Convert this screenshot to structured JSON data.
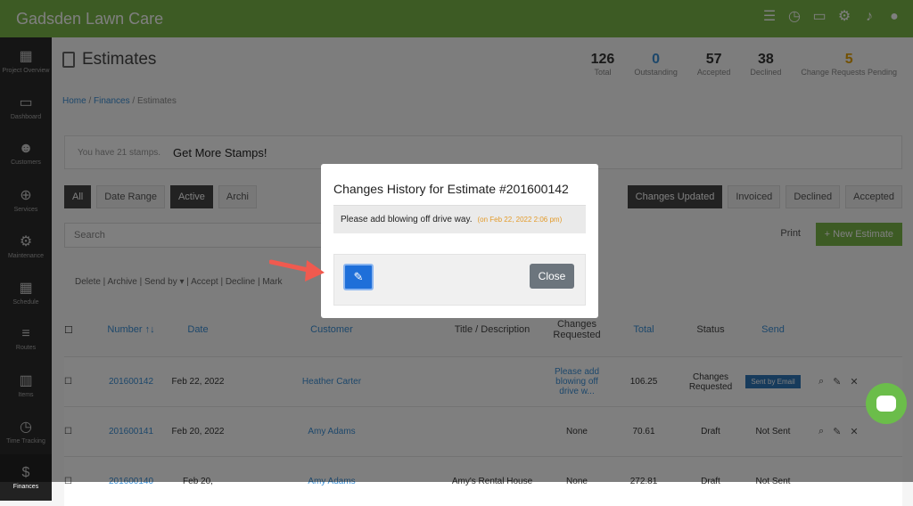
{
  "app": {
    "title": "Gadsden Lawn Care"
  },
  "top_icons": [
    "checklist-icon",
    "clock-icon",
    "message-icon",
    "gear-icon",
    "bell-icon",
    "user-icon"
  ],
  "sidebar": {
    "items": [
      {
        "label": "Project Overview",
        "icon": "grid-icon"
      },
      {
        "label": "Dashboard",
        "icon": "monitor-icon"
      },
      {
        "label": "Customers",
        "icon": "users-icon"
      },
      {
        "label": "Services",
        "icon": "plus-icon"
      },
      {
        "label": "Maintenance",
        "icon": "gears-icon"
      },
      {
        "label": "Schedule",
        "icon": "calendar-icon"
      },
      {
        "label": "Routes",
        "icon": "list-icon"
      },
      {
        "label": "Items",
        "icon": "trash-icon"
      },
      {
        "label": "Time Tracking",
        "icon": "clock-icon"
      },
      {
        "label": "Finances",
        "icon": "dollar-icon"
      }
    ]
  },
  "header": {
    "title": "Estimates"
  },
  "stats": [
    {
      "value": "126",
      "label": "Total",
      "color": "#333333"
    },
    {
      "value": "0",
      "label": "Outstanding",
      "color": "#3a8fd6"
    },
    {
      "value": "57",
      "label": "Accepted",
      "color": "#333333"
    },
    {
      "value": "38",
      "label": "Declined",
      "color": "#333333"
    },
    {
      "value": "5",
      "label": "Change Requests Pending",
      "color": "#e5a100"
    }
  ],
  "breadcrumb": {
    "home": "Home",
    "finances": "Finances",
    "current": "Estimates"
  },
  "stamps": {
    "text": "You have 21 stamps.",
    "link": "Get More Stamps!"
  },
  "filters": {
    "all": "All",
    "date_range": "Date Range",
    "active": "Active",
    "archived": "Archi"
  },
  "filters_right": {
    "changes_updated": "Changes Updated",
    "invoiced": "Invoiced",
    "declined": "Declined",
    "accepted": "Accepted"
  },
  "search": {
    "placeholder": "Search"
  },
  "toolbar": {
    "print": "Print",
    "new": "+ New Estimate"
  },
  "bulk_actions": "Delete | Archive | Send by ▾ | Accept | Decline | Mark",
  "table": {
    "headers": [
      "Number ↑↓",
      "Date",
      "Customer",
      "Title / Description",
      "Changes Requested",
      "Total",
      "Status",
      "Send"
    ],
    "rows": [
      {
        "number": "201600142",
        "date": "Feb 22, 2022",
        "customer": "Heather Carter",
        "title": "",
        "changes": "Please add blowing off drive w...",
        "total": "106.25",
        "status": "Changes Requested",
        "send": "Sent by Email"
      },
      {
        "number": "201600141",
        "date": "Feb 20, 2022",
        "customer": "Amy Adams",
        "title": "",
        "changes": "None",
        "total": "70.61",
        "status": "Draft",
        "send": "Not Sent"
      },
      {
        "number": "201600140",
        "date": "Feb 20,",
        "customer": "Amy Adams",
        "title": "Amy's Rental House",
        "changes": "None",
        "total": "272.81",
        "status": "Draft",
        "send": "Not Sent"
      }
    ]
  },
  "modal": {
    "title": "Changes History for Estimate #201600142",
    "history_message": "Please add blowing off drive way.",
    "history_time": "(on Feb 22, 2022 2:06 pm)",
    "close_label": "Close"
  },
  "colors": {
    "brand": "#7ab648",
    "edit_button": "#1e6fd9",
    "arrow": "#f05a4f"
  }
}
